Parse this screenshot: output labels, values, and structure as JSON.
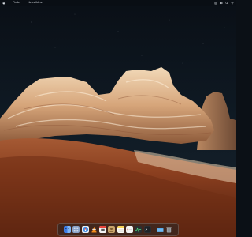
{
  "menubar": {
    "apple_icon": "apple-logo-icon",
    "app_name": "Finder",
    "items": [
      "Netxwilderz"
    ],
    "tray_icons": [
      "control-center-icon",
      "battery-icon",
      "search-icon",
      "wifi-icon"
    ]
  },
  "dock": {
    "apps": [
      {
        "name": "finder-icon",
        "color": "#3d7ee8"
      },
      {
        "name": "launchpad-icon",
        "color": "#8aa3c8"
      },
      {
        "name": "safari-icon",
        "color": "#3f8fe6"
      },
      {
        "name": "vlc-icon",
        "color": "#f28c1e"
      },
      {
        "name": "calendar-icon",
        "color": "#f4f4f4"
      },
      {
        "name": "contacts-icon",
        "color": "#c9a46a"
      },
      {
        "name": "notes-icon",
        "color": "#f7d35a"
      },
      {
        "name": "reminders-icon",
        "color": "#e9e9e9"
      },
      {
        "name": "activity-monitor-icon",
        "color": "#2b2f33"
      },
      {
        "name": "terminal-icon",
        "color": "#1e2226"
      }
    ],
    "trailing": [
      {
        "name": "folder-icon",
        "color": "#4aa3e8"
      },
      {
        "name": "trash-icon",
        "color": "#9aa0a6"
      }
    ]
  },
  "wallpaper": {
    "name": "rock-formation-wallpaper"
  }
}
